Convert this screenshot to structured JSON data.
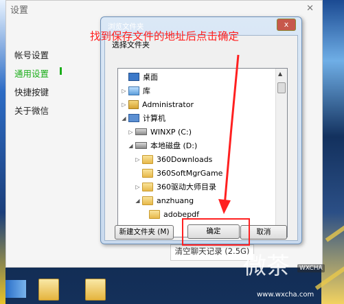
{
  "settings": {
    "title": "设置",
    "menu": [
      "帐号设置",
      "通用设置",
      "快捷按键",
      "关于微信"
    ],
    "active_index": 1,
    "clear_button": "清空聊天记录 (2.5G)"
  },
  "dialog": {
    "title": "浏览文件夹",
    "close": "x",
    "prompt": "选择文件夹",
    "tree": [
      {
        "label": "桌面",
        "icon": "monitor-icon",
        "arrow": ""
      },
      {
        "label": "库",
        "icon": "library-icon",
        "arrow": "▷"
      },
      {
        "label": "Administrator",
        "icon": "user-folder-icon",
        "arrow": "▷"
      },
      {
        "label": "计算机",
        "icon": "computer-icon",
        "arrow": "◢"
      },
      {
        "label": "WINXP (C:)",
        "icon": "drive-icon",
        "arrow": "▷"
      },
      {
        "label": "本地磁盘 (D:)",
        "icon": "drive-icon",
        "arrow": "◢"
      },
      {
        "label": "360Downloads",
        "icon": "folder-icon",
        "arrow": "▷"
      },
      {
        "label": "360SoftMgrGame",
        "icon": "folder-icon",
        "arrow": ""
      },
      {
        "label": "360驱动大师目录",
        "icon": "folder-icon",
        "arrow": "▷"
      },
      {
        "label": "anzhuang",
        "icon": "folder-icon",
        "arrow": "◢"
      },
      {
        "label": "adobepdf",
        "icon": "folder-icon",
        "arrow": ""
      }
    ],
    "new_folder_button": "新建文件夹 (M)",
    "ok_button": "确定",
    "cancel_button": "取消"
  },
  "annotation": "找到保存文件的地址后点击确定",
  "watermark": {
    "text": "微茶",
    "badge": "WXCHA",
    "url": "www.wxcha.com"
  },
  "colors": {
    "annotation": "#ff2020",
    "active_menu": "#1aad19"
  }
}
